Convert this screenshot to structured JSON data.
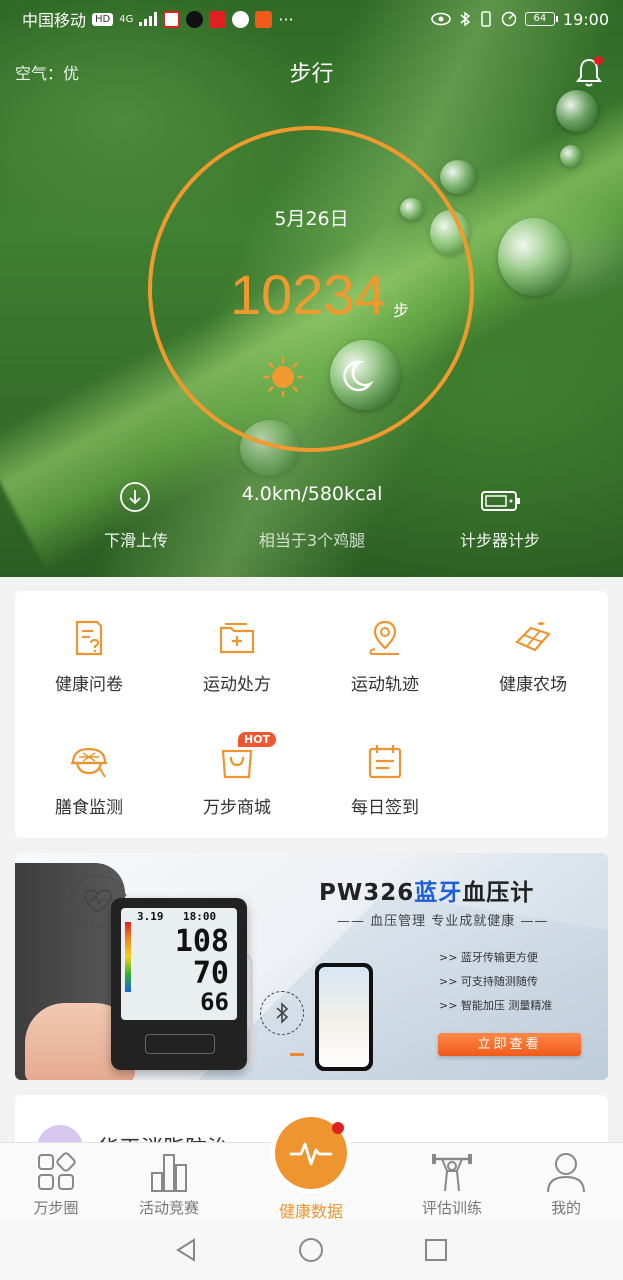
{
  "status_bar": {
    "carrier": "中国移动",
    "hd": "HD",
    "network": "4G",
    "battery": "64",
    "time": "19:00"
  },
  "header": {
    "air_quality": "空气：优",
    "title": "步行"
  },
  "summary": {
    "date": "5月26日",
    "steps": "10234",
    "steps_unit": "步",
    "distance_kcal": "4.0km/580kcal",
    "equivalent": "相当于3个鸡腿",
    "upload_label": "下滑上传",
    "pedometer_label": "计步器计步"
  },
  "features": [
    {
      "label": "健康问卷",
      "icon": "questionnaire-icon"
    },
    {
      "label": "运动处方",
      "icon": "prescription-folder-icon"
    },
    {
      "label": "运动轨迹",
      "icon": "location-track-icon"
    },
    {
      "label": "健康农场",
      "icon": "farm-icon"
    },
    {
      "label": "膳食监测",
      "icon": "food-bowl-icon"
    },
    {
      "label": "万步商城",
      "icon": "shopping-bag-icon",
      "badge": "HOT"
    },
    {
      "label": "每日签到",
      "icon": "calendar-checkin-icon"
    }
  ],
  "banner": {
    "title_prefix": "PW326",
    "title_blue": "蓝牙",
    "title_suffix": "血压计",
    "subtitle": "—— 血压管理 专业成就健康 ——",
    "bullets": [
      ">> 蓝牙传输更方便",
      ">> 可支持随测随传",
      ">> 智能加压 测量精准"
    ],
    "button": "立即查看",
    "device_screen": {
      "date": "3.19",
      "time": "18:00",
      "sys": "108",
      "dia": "70",
      "pulse": "66"
    }
  },
  "card2": {
    "text": "华平消脂防治"
  },
  "tabbar": {
    "tabs": [
      {
        "label": "万步圈",
        "icon": "community-icon"
      },
      {
        "label": "活动竞赛",
        "icon": "bar-chart-icon"
      },
      {
        "label": "健康数据",
        "icon": "pulse-icon",
        "active": true
      },
      {
        "label": "评估训练",
        "icon": "weightlifting-icon"
      },
      {
        "label": "我的",
        "icon": "user-icon"
      }
    ]
  },
  "colors": {
    "accent": "#ee9530",
    "ring": "#f0992f",
    "badge_red": "#e02020",
    "banner_blue": "#1f5fd8",
    "banner_button": "#f05a1a"
  }
}
